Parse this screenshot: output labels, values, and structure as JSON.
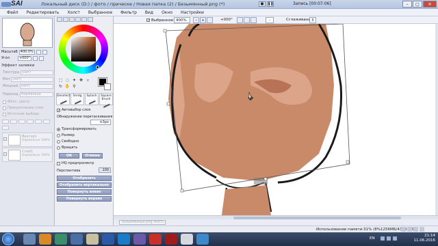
{
  "titlebar": {
    "app_name": "SAI",
    "title": "Локальный диск (D:) / фото / прическе / Новая папка (2) / Безымянный.png (*)",
    "recording": "Запись [00:07:06]"
  },
  "menu": [
    "Файл",
    "Редактировать",
    "Холст",
    "Выбранное",
    "Фильтр",
    "Вид",
    "Окно",
    "Настройки"
  ],
  "navigator": {
    "zoom_label": "Масштаб",
    "zoom_value": "400.0%",
    "angle_label": "Угол",
    "angle_value": "+000°"
  },
  "fill_effect": {
    "heading": "Эффект заливки",
    "rows": [
      {
        "label": "Текстура",
        "value": "(нет)"
      },
      {
        "label": "Мяч",
        "value": "(нет)"
      },
      {
        "label": "Мощный",
        "value": "(нет)"
      },
      {
        "label": "Переход",
        "value": "Нормально"
      }
    ],
    "checks": [
      "Фикс. цвета",
      "Прикрепление слоя",
      "Источник выбора"
    ]
  },
  "layers": [
    {
      "name": "Вектор1",
      "mode": "Нормально\n100%"
    },
    {
      "name": "Слой1",
      "mode": "Нормально\n100%"
    }
  ],
  "tools": {
    "brushes": [
      "Deselect",
      "Smdg",
      "Splash",
      "Square Brush"
    ],
    "auto_select_layer": "Автовыбор слоя",
    "drag_detect_label": "Обнаружение перетаскивания",
    "drag_detect_value": "±3px",
    "modes": [
      "Трансформировать",
      "Размер",
      "Свободно",
      "Вращать"
    ],
    "selected_mode": "Трансформировать",
    "ok": "ОК",
    "cancel": "Отмена",
    "hq_preview": "HQ предпросмотр",
    "perspective_label": "Перспектива",
    "perspective_value": "100",
    "buttons": [
      "Отобразить горизонтально",
      "Отобразить вертикально",
      "Повернуть влево",
      "Повернуть вправо"
    ]
  },
  "canvas_toolbar": {
    "selected_label": "Выбранное",
    "zoom": "400%",
    "angle": "+000°",
    "smoothing_label": "Сглаживание",
    "smoothing_value": "3",
    "arrow": "->"
  },
  "doc_tab": {
    "name": "Безымянный.png",
    "zoom": "400%"
  },
  "status": {
    "memory": "Использование памяти:31% (8%1256МБ/4398 МБ)"
  },
  "tray": {
    "lang": "EN",
    "time": "21:14",
    "date": "11.06.2016"
  },
  "colors": {
    "skin": "#c98a6a",
    "skin_shadow": "#b87256",
    "skin_light": "#dca58a",
    "outline": "#1a1a1a",
    "accent": "#8e9abb"
  }
}
